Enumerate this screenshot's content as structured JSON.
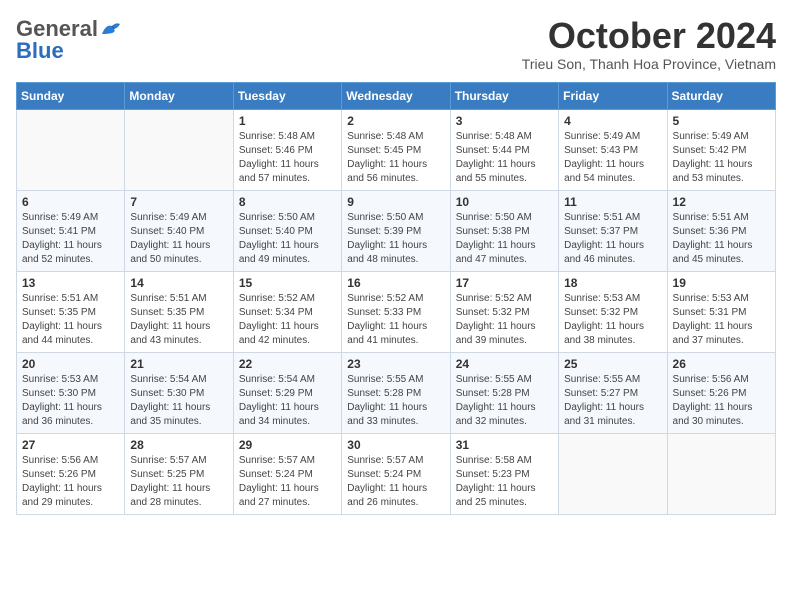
{
  "logo": {
    "general": "General",
    "blue": "Blue"
  },
  "header": {
    "month": "October 2024",
    "location": "Trieu Son, Thanh Hoa Province, Vietnam"
  },
  "weekdays": [
    "Sunday",
    "Monday",
    "Tuesday",
    "Wednesday",
    "Thursday",
    "Friday",
    "Saturday"
  ],
  "weeks": [
    [
      {
        "day": "",
        "info": ""
      },
      {
        "day": "",
        "info": ""
      },
      {
        "day": "1",
        "info": "Sunrise: 5:48 AM\nSunset: 5:46 PM\nDaylight: 11 hours\nand 57 minutes."
      },
      {
        "day": "2",
        "info": "Sunrise: 5:48 AM\nSunset: 5:45 PM\nDaylight: 11 hours\nand 56 minutes."
      },
      {
        "day": "3",
        "info": "Sunrise: 5:48 AM\nSunset: 5:44 PM\nDaylight: 11 hours\nand 55 minutes."
      },
      {
        "day": "4",
        "info": "Sunrise: 5:49 AM\nSunset: 5:43 PM\nDaylight: 11 hours\nand 54 minutes."
      },
      {
        "day": "5",
        "info": "Sunrise: 5:49 AM\nSunset: 5:42 PM\nDaylight: 11 hours\nand 53 minutes."
      }
    ],
    [
      {
        "day": "6",
        "info": "Sunrise: 5:49 AM\nSunset: 5:41 PM\nDaylight: 11 hours\nand 52 minutes."
      },
      {
        "day": "7",
        "info": "Sunrise: 5:49 AM\nSunset: 5:40 PM\nDaylight: 11 hours\nand 50 minutes."
      },
      {
        "day": "8",
        "info": "Sunrise: 5:50 AM\nSunset: 5:40 PM\nDaylight: 11 hours\nand 49 minutes."
      },
      {
        "day": "9",
        "info": "Sunrise: 5:50 AM\nSunset: 5:39 PM\nDaylight: 11 hours\nand 48 minutes."
      },
      {
        "day": "10",
        "info": "Sunrise: 5:50 AM\nSunset: 5:38 PM\nDaylight: 11 hours\nand 47 minutes."
      },
      {
        "day": "11",
        "info": "Sunrise: 5:51 AM\nSunset: 5:37 PM\nDaylight: 11 hours\nand 46 minutes."
      },
      {
        "day": "12",
        "info": "Sunrise: 5:51 AM\nSunset: 5:36 PM\nDaylight: 11 hours\nand 45 minutes."
      }
    ],
    [
      {
        "day": "13",
        "info": "Sunrise: 5:51 AM\nSunset: 5:35 PM\nDaylight: 11 hours\nand 44 minutes."
      },
      {
        "day": "14",
        "info": "Sunrise: 5:51 AM\nSunset: 5:35 PM\nDaylight: 11 hours\nand 43 minutes."
      },
      {
        "day": "15",
        "info": "Sunrise: 5:52 AM\nSunset: 5:34 PM\nDaylight: 11 hours\nand 42 minutes."
      },
      {
        "day": "16",
        "info": "Sunrise: 5:52 AM\nSunset: 5:33 PM\nDaylight: 11 hours\nand 41 minutes."
      },
      {
        "day": "17",
        "info": "Sunrise: 5:52 AM\nSunset: 5:32 PM\nDaylight: 11 hours\nand 39 minutes."
      },
      {
        "day": "18",
        "info": "Sunrise: 5:53 AM\nSunset: 5:32 PM\nDaylight: 11 hours\nand 38 minutes."
      },
      {
        "day": "19",
        "info": "Sunrise: 5:53 AM\nSunset: 5:31 PM\nDaylight: 11 hours\nand 37 minutes."
      }
    ],
    [
      {
        "day": "20",
        "info": "Sunrise: 5:53 AM\nSunset: 5:30 PM\nDaylight: 11 hours\nand 36 minutes."
      },
      {
        "day": "21",
        "info": "Sunrise: 5:54 AM\nSunset: 5:30 PM\nDaylight: 11 hours\nand 35 minutes."
      },
      {
        "day": "22",
        "info": "Sunrise: 5:54 AM\nSunset: 5:29 PM\nDaylight: 11 hours\nand 34 minutes."
      },
      {
        "day": "23",
        "info": "Sunrise: 5:55 AM\nSunset: 5:28 PM\nDaylight: 11 hours\nand 33 minutes."
      },
      {
        "day": "24",
        "info": "Sunrise: 5:55 AM\nSunset: 5:28 PM\nDaylight: 11 hours\nand 32 minutes."
      },
      {
        "day": "25",
        "info": "Sunrise: 5:55 AM\nSunset: 5:27 PM\nDaylight: 11 hours\nand 31 minutes."
      },
      {
        "day": "26",
        "info": "Sunrise: 5:56 AM\nSunset: 5:26 PM\nDaylight: 11 hours\nand 30 minutes."
      }
    ],
    [
      {
        "day": "27",
        "info": "Sunrise: 5:56 AM\nSunset: 5:26 PM\nDaylight: 11 hours\nand 29 minutes."
      },
      {
        "day": "28",
        "info": "Sunrise: 5:57 AM\nSunset: 5:25 PM\nDaylight: 11 hours\nand 28 minutes."
      },
      {
        "day": "29",
        "info": "Sunrise: 5:57 AM\nSunset: 5:24 PM\nDaylight: 11 hours\nand 27 minutes."
      },
      {
        "day": "30",
        "info": "Sunrise: 5:57 AM\nSunset: 5:24 PM\nDaylight: 11 hours\nand 26 minutes."
      },
      {
        "day": "31",
        "info": "Sunrise: 5:58 AM\nSunset: 5:23 PM\nDaylight: 11 hours\nand 25 minutes."
      },
      {
        "day": "",
        "info": ""
      },
      {
        "day": "",
        "info": ""
      }
    ]
  ]
}
